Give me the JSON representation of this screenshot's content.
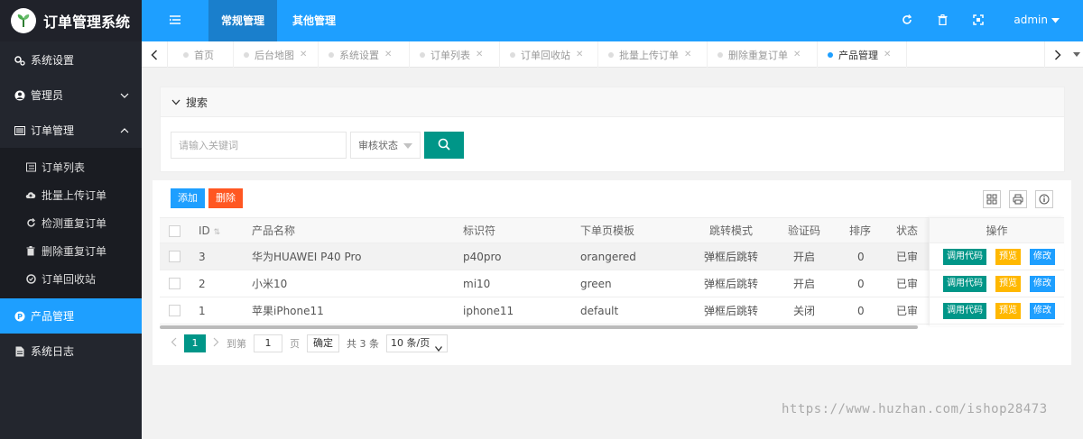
{
  "app": {
    "title": "订单管理系统"
  },
  "sidebar": {
    "items": [
      {
        "label": "系统设置",
        "icon": "gears-icon"
      },
      {
        "label": "管理员",
        "icon": "user-icon",
        "arrow": "chevron-down"
      },
      {
        "label": "订单管理",
        "icon": "list-icon",
        "arrow": "chevron-up"
      }
    ],
    "sub_items": [
      {
        "label": "订单列表",
        "icon": "list-icon"
      },
      {
        "label": "批量上传订单",
        "icon": "cloud-upload-icon"
      },
      {
        "label": "检测重复订单",
        "icon": "refresh-icon"
      },
      {
        "label": "删除重复订单",
        "icon": "trash-icon"
      },
      {
        "label": "订单回收站",
        "icon": "recycle-icon"
      }
    ],
    "active": {
      "label": "产品管理",
      "icon": "product-icon"
    },
    "last": {
      "label": "系统日志",
      "icon": "file-icon"
    }
  },
  "header": {
    "tabs": [
      "常规管理",
      "其他管理"
    ],
    "user": "admin"
  },
  "tabbar": {
    "tabs": [
      "首页",
      "后台地图",
      "系统设置",
      "订单列表",
      "订单回收站",
      "批量上传订单",
      "删除重复订单",
      "产品管理"
    ]
  },
  "search": {
    "title": "搜索",
    "placeholder": "请输入关键词",
    "status_label": "审核状态"
  },
  "toolbar": {
    "add": "添加",
    "delete": "删除"
  },
  "table": {
    "headers": {
      "id": "ID",
      "name": "产品名称",
      "code": "标识符",
      "template": "下单页模板",
      "mode": "跳转模式",
      "captcha": "验证码",
      "sort": "排序",
      "status": "状态",
      "ops": "操作"
    },
    "rows": [
      {
        "id": "3",
        "name": "华为HUAWEI P40 Pro",
        "code": "p40pro",
        "template": "orangered",
        "mode": "弹框后跳转",
        "captcha": "开启",
        "sort": "0",
        "status": "已审"
      },
      {
        "id": "2",
        "name": "小米10",
        "code": "mi10",
        "template": "green",
        "mode": "弹框后跳转",
        "captcha": "开启",
        "sort": "0",
        "status": "已审"
      },
      {
        "id": "1",
        "name": "苹果iPhone11",
        "code": "iphone11",
        "template": "default",
        "mode": "弹框后跳转",
        "captcha": "关闭",
        "sort": "0",
        "status": "已审"
      }
    ],
    "ops": {
      "code": "调用代码",
      "preview": "预览",
      "edit": "修改"
    }
  },
  "pager": {
    "current": "1",
    "goto_label": "到第",
    "page_value": "1",
    "page_unit": "页",
    "confirm": "确定",
    "total": "共 3 条",
    "per_page": "10 条/页"
  },
  "watermark": "https://www.huzhan.com/ishop28473",
  "colors": {
    "primary": "#1e9fff",
    "green": "#009688",
    "orange": "#ff5722",
    "yellow": "#ffb800",
    "sidebar": "#23262e"
  }
}
